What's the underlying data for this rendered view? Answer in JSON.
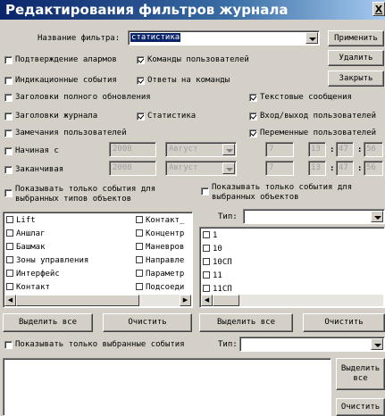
{
  "window": {
    "title": "Редактирования фильтров журнала",
    "close_label": "X"
  },
  "filter_name": {
    "label": "Название фильтра:",
    "value": "статистика"
  },
  "buttons": {
    "apply": "Применить",
    "delete": "Удалить",
    "close": "Закрыть",
    "select_all": "Выделить все",
    "clear": "Очистить",
    "select_all_bottom": "Выделить все",
    "clear_bottom": "Очистить"
  },
  "checkboxes": {
    "alarm_confirm": {
      "label": "Подтверждение алармов",
      "checked": false
    },
    "user_commands": {
      "label": "Команды пользователей",
      "checked": true
    },
    "indication_events": {
      "label": "Индикационные события",
      "checked": false
    },
    "command_responses": {
      "label": "Ответы на команды",
      "checked": true
    },
    "full_update_headers": {
      "label": "Заголовки полного обновления",
      "checked": false
    },
    "text_messages": {
      "label": "Текстовые сообщения",
      "checked": true
    },
    "journal_headers": {
      "label": "Заголовки журнала",
      "checked": false
    },
    "statistics": {
      "label": "Статистика",
      "checked": true
    },
    "user_login": {
      "label": "Вход/выход пользователей",
      "checked": true
    },
    "user_remarks": {
      "label": "Замечания пользователей",
      "checked": false
    },
    "variable_users": {
      "label": "Переменные пользователей",
      "checked": true
    },
    "start": {
      "label": "Начиная с",
      "checked": false
    },
    "end": {
      "label": "Заканчивая",
      "checked": false
    },
    "only_types": {
      "label": "Показывать только события для выбранных типов объектов",
      "checked": false
    },
    "only_objects": {
      "label": "Показывать только события для выбранных объектов",
      "checked": false
    },
    "only_selected": {
      "label": "Показывать только выбранные события",
      "checked": false
    }
  },
  "date_start": {
    "year": "2008",
    "month": "Август",
    "day": "7",
    "hour": "13",
    "minute": "47",
    "second": "56"
  },
  "date_end": {
    "year": "2008",
    "month": "Август",
    "day": "7",
    "hour": "13",
    "minute": "47",
    "second": "56"
  },
  "time_separator": ":",
  "type_label": "Тип:",
  "object_types": [
    "Lift",
    "Контакт_",
    "Аншлаг",
    "Концентр",
    "Башмак",
    "Маневров",
    "Зоны управления",
    "Направле",
    "Интерфейс",
    "Параметр",
    "Контакт",
    "Подсоеди"
  ],
  "objects": [
    "1",
    "10",
    "10СП",
    "11",
    "11СП"
  ],
  "scroll_arrows": {
    "left": "◀",
    "right": "▶"
  }
}
